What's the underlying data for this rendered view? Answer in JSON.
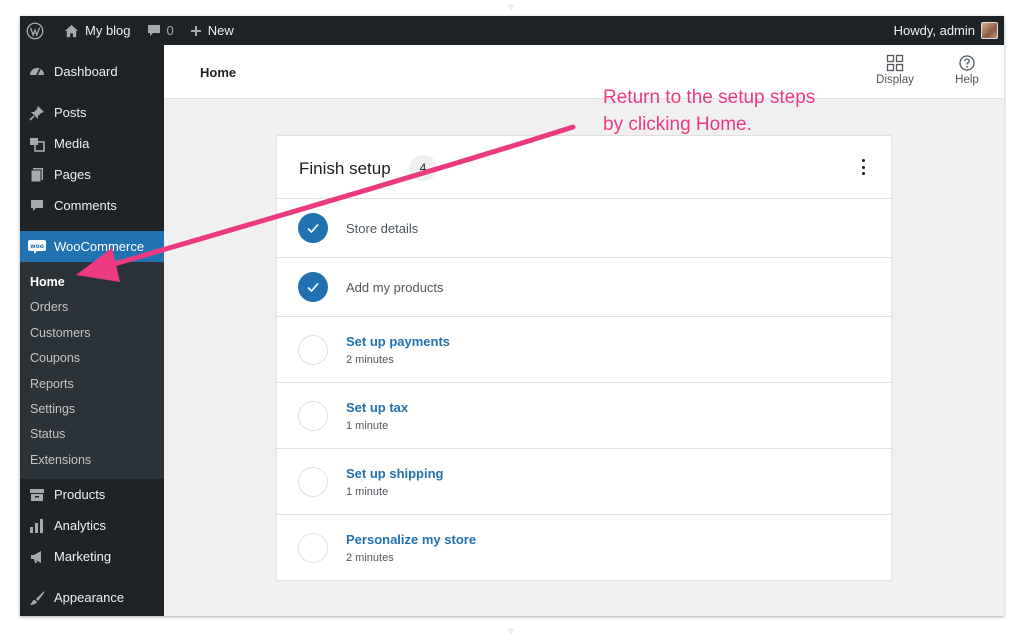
{
  "adminbar": {
    "site_name": "My blog",
    "comments_count": "0",
    "new_label": "New",
    "greeting": "Howdy, admin"
  },
  "sidebar": {
    "items_top": [
      {
        "label": "Dashboard",
        "icon": "dashboard-icon"
      },
      {
        "label": "Posts",
        "icon": "pin-icon"
      },
      {
        "label": "Media",
        "icon": "media-icon"
      },
      {
        "label": "Pages",
        "icon": "pages-icon"
      },
      {
        "label": "Comments",
        "icon": "comment-icon"
      }
    ],
    "active": {
      "label": "WooCommerce",
      "icon": "woo-icon"
    },
    "submenu": [
      "Home",
      "Orders",
      "Customers",
      "Coupons",
      "Reports",
      "Settings",
      "Status",
      "Extensions"
    ],
    "items_bottom": [
      {
        "label": "Products",
        "icon": "archive-icon"
      },
      {
        "label": "Analytics",
        "icon": "bar-chart-icon"
      },
      {
        "label": "Marketing",
        "icon": "megaphone-icon"
      },
      {
        "label": "Appearance",
        "icon": "brush-icon"
      }
    ]
  },
  "header": {
    "title": "Home",
    "display_label": "Display",
    "help_label": "Help"
  },
  "card": {
    "title": "Finish setup",
    "badge": "4",
    "tasks": [
      {
        "label": "Store details",
        "done": true
      },
      {
        "label": "Add my products",
        "done": true
      },
      {
        "label": "Set up payments",
        "time": "2 minutes",
        "done": false
      },
      {
        "label": "Set up tax",
        "time": "1 minute",
        "done": false
      },
      {
        "label": "Set up shipping",
        "time": "1 minute",
        "done": false
      },
      {
        "label": "Personalize my store",
        "time": "2 minutes",
        "done": false
      }
    ]
  },
  "annotation": {
    "line1": "Return to the setup steps",
    "line2": "by clicking Home.",
    "color": "#ec3a80"
  },
  "colors": {
    "sidebar_bg": "#1d2327",
    "accent": "#2271b1",
    "page_bg": "#f0f0f1"
  }
}
